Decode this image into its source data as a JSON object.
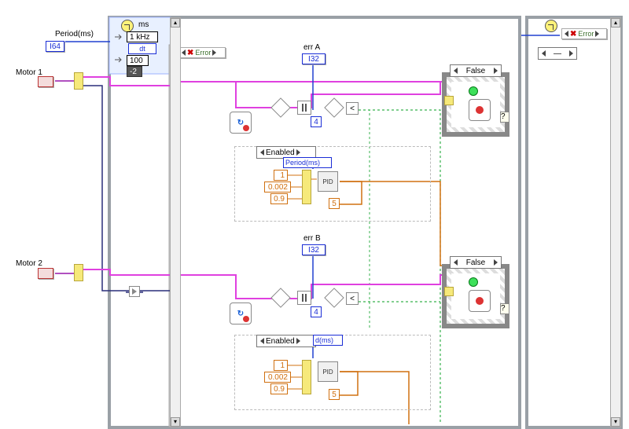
{
  "units": "ms",
  "period_label": "Period(ms)",
  "period_dtype": "I64",
  "clock": {
    "rate": "1 kHz",
    "dt_label": "dt",
    "count": "100",
    "neg": "-2"
  },
  "error_label": "Error",
  "motors": [
    "Motor 1",
    "Motor 2"
  ],
  "err_indicators": {
    "a_label": "err A",
    "b_label": "err B",
    "dtype": "I32"
  },
  "case_false": "False",
  "enabled_label": "Enabled",
  "period_ref": "Period(ms)",
  "period_ref_short": "d(ms)",
  "pid": {
    "label": "PID",
    "Kp": "1",
    "Ki": "0.002",
    "Kd": "0.9",
    "out_limit": "5"
  },
  "compare_const": "4",
  "right_panel": {
    "error_label": "Error"
  }
}
